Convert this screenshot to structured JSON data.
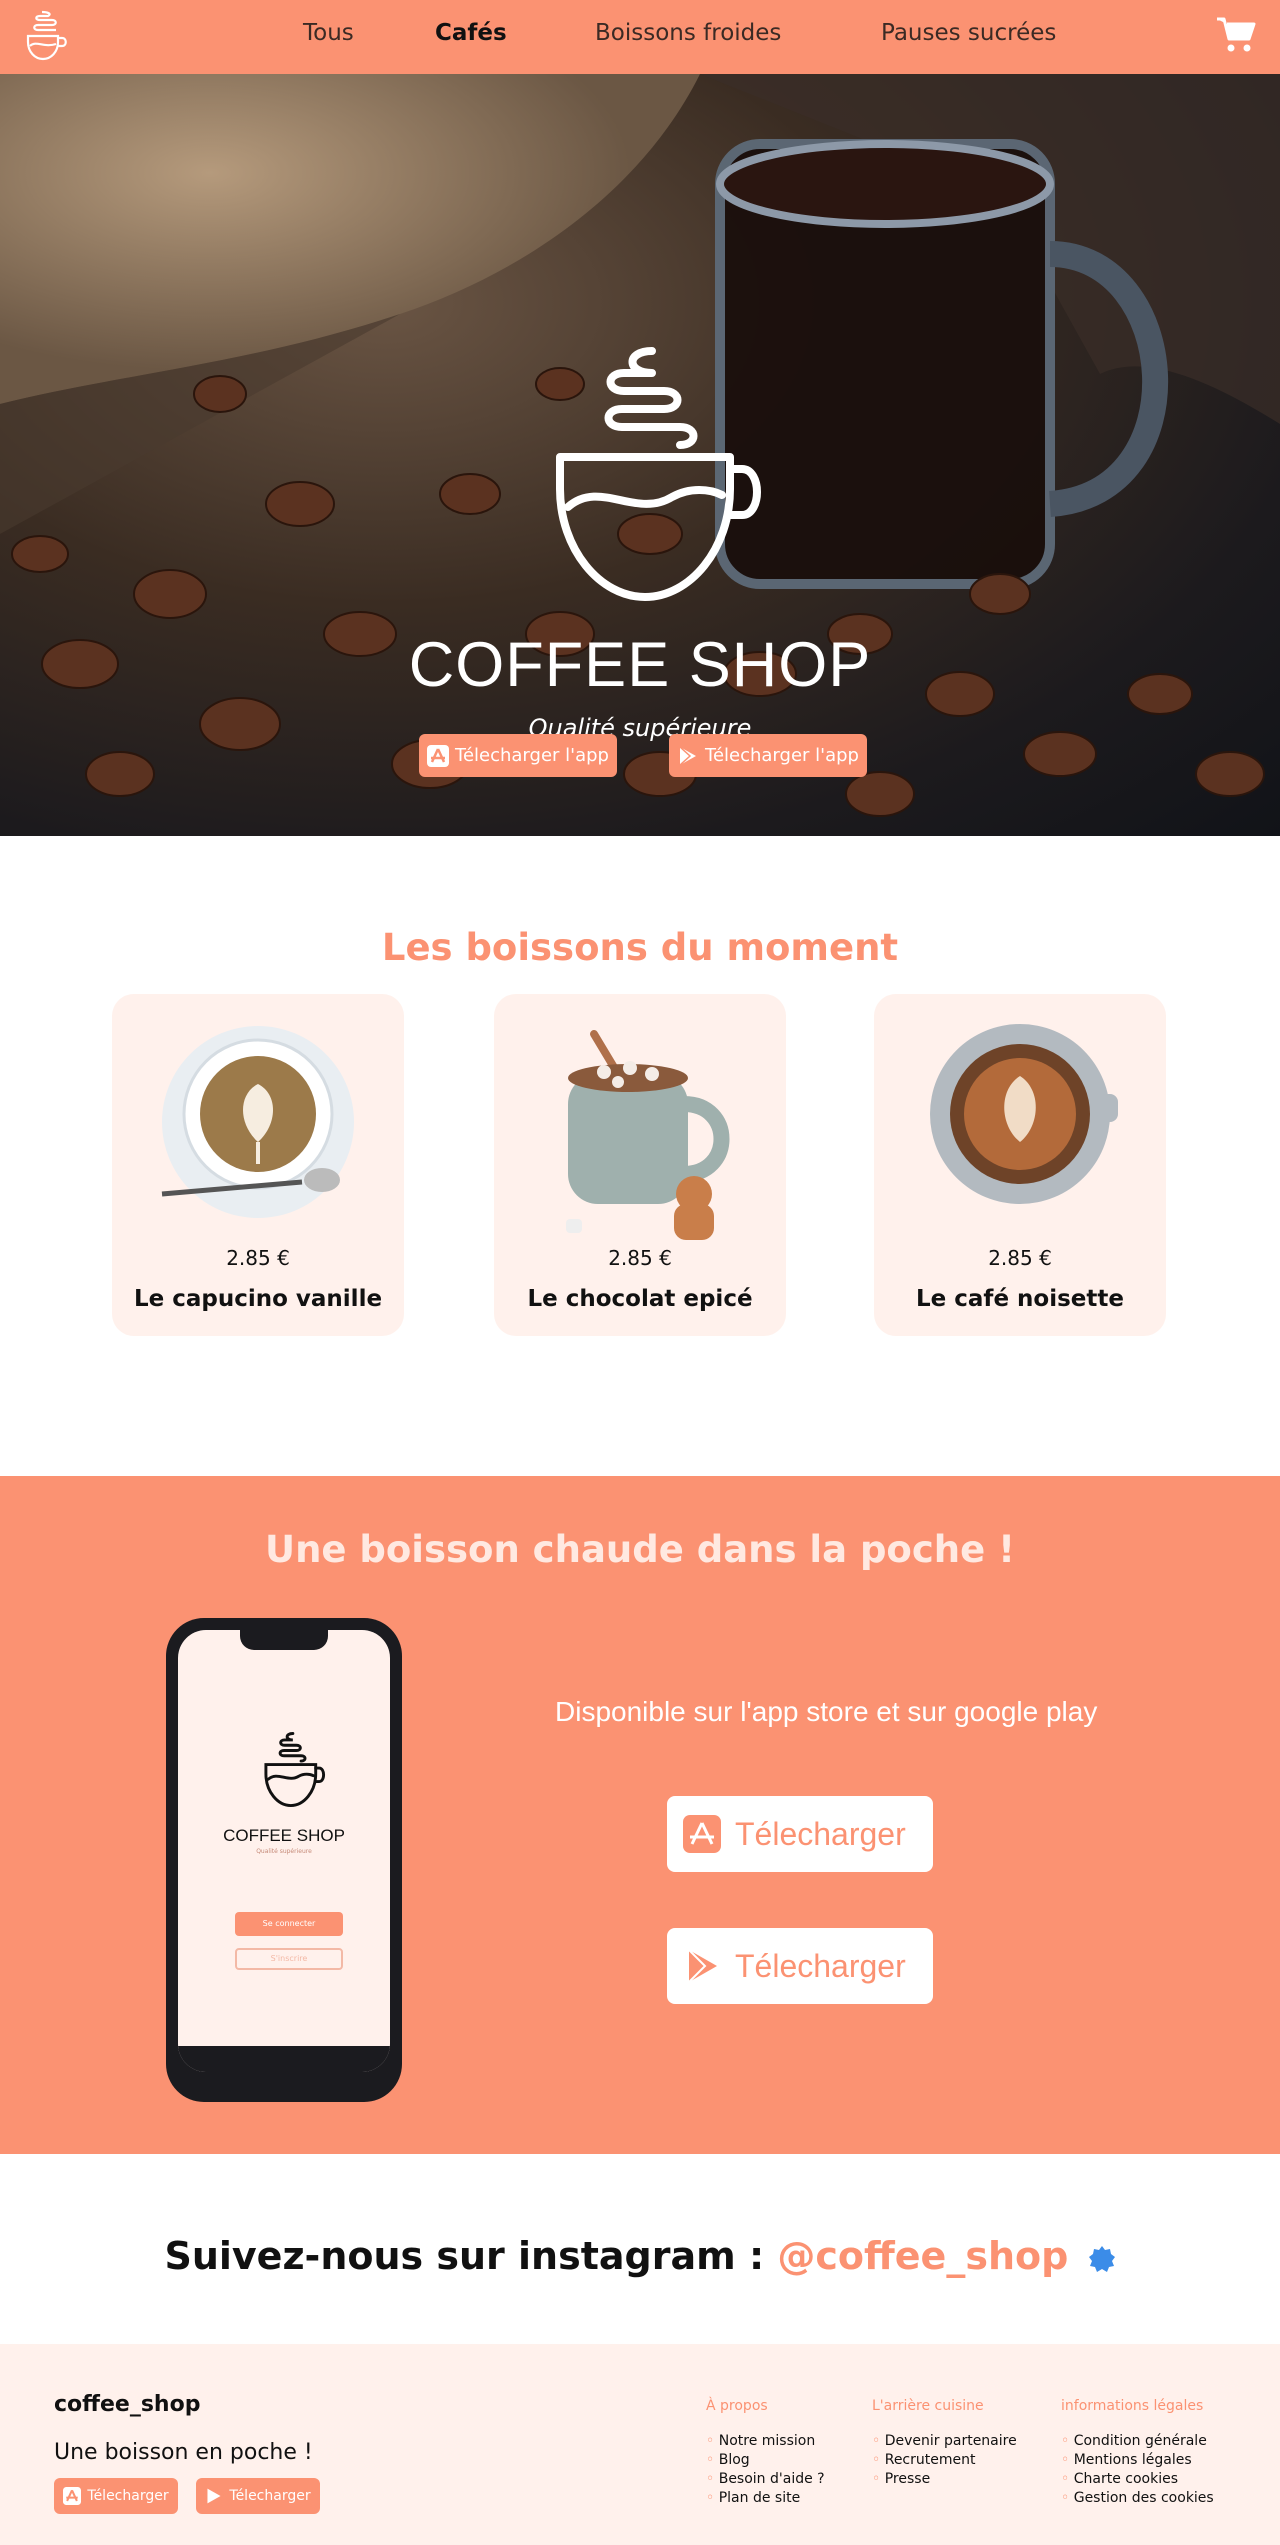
{
  "nav": {
    "tabs": [
      {
        "label": "Tous",
        "active": false
      },
      {
        "label": "Cafés",
        "active": true
      },
      {
        "label": "Boissons froides",
        "active": false
      },
      {
        "label": "Pauses sucrées",
        "active": false
      }
    ],
    "logo_icon": "coffee-cup-logo-icon",
    "cart_icon": "cart-icon"
  },
  "hero": {
    "brand": "COFFEE SHOP",
    "tagline": "Qualité supérieure",
    "buttons": [
      {
        "label": "Télecharger l'app",
        "icon": "app-store-icon"
      },
      {
        "label": "Télecharger l'app",
        "icon": "google-play-icon"
      }
    ]
  },
  "moment": {
    "title": "Les boissons du moment",
    "items": [
      {
        "name": "Le capucino vanille",
        "price": "2.85 €"
      },
      {
        "name": "Le chocolat epicé",
        "price": "2.85 €"
      },
      {
        "name": "Le café noisette",
        "price": "2.85 €"
      }
    ]
  },
  "app": {
    "title": "Une boisson chaude dans la poche !",
    "available": "Disponible sur l'app store et sur google play",
    "phone": {
      "brand": "COFFEE SHOP",
      "sub": "Qualité supérieure",
      "login": "Se connecter",
      "signup": "S'inscrire"
    },
    "store_buttons": [
      {
        "label": "Télecharger",
        "icon": "app-store-icon"
      },
      {
        "label": "Télecharger",
        "icon": "google-play-icon"
      }
    ]
  },
  "instagram": {
    "prefix": "Suivez-nous sur instagram : ",
    "handle": "@coffee_shop"
  },
  "footer": {
    "name": "coffee_shop",
    "tagline": "Une boisson en poche !",
    "buttons": [
      {
        "label": "Télecharger",
        "icon": "app-store-icon"
      },
      {
        "label": "Télecharger",
        "icon": "google-play-icon"
      }
    ],
    "columns": [
      {
        "title": "À propos",
        "links": [
          "Notre mission",
          "Blog",
          "Besoin d'aide ?",
          "Plan de site"
        ]
      },
      {
        "title": "L'arrière cuisine",
        "links": [
          "Devenir partenaire",
          "Recrutement",
          "Presse"
        ]
      },
      {
        "title": "informations légales",
        "links": [
          "Condition générale",
          "Mentions légales",
          "Charte cookies",
          "Gestion des cookies"
        ]
      }
    ]
  },
  "colors": {
    "accent": "#fb9272",
    "card": "#fff1ec",
    "verified": "#3b8ce8"
  }
}
